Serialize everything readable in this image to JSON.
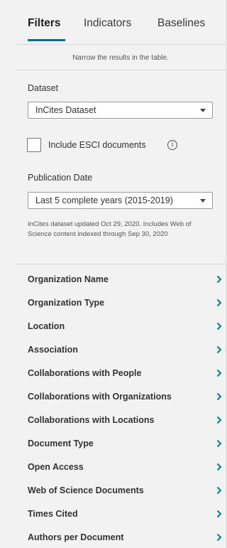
{
  "tabs": [
    {
      "label": "Filters",
      "active": true
    },
    {
      "label": "Indicators",
      "active": false
    },
    {
      "label": "Baselines",
      "active": false
    }
  ],
  "hint": "Narrow the results in the table.",
  "dataset": {
    "label": "Dataset",
    "selected": "InCites Dataset"
  },
  "esci": {
    "label": "Include ESCI documents",
    "checked": false,
    "info_icon": "info-icon"
  },
  "publication_date": {
    "label": "Publication Date",
    "selected": "Last 5 complete years (2015-2019)"
  },
  "dataset_note": "InCites dataset updated Oct 29, 2020. Includes Web of Science content indexed through Sep 30, 2020",
  "filters": [
    "Organization Name",
    "Organization Type",
    "Location",
    "Association",
    "Collaborations with People",
    "Collaborations with Organizations",
    "Collaborations with Locations",
    "Document Type",
    "Open Access",
    "Web of Science Documents",
    "Times Cited",
    "Authors per Document"
  ],
  "colors": {
    "accent": "#0a6f82",
    "panel_bg": "#f2f2f2",
    "chevron": "#0a7a8c"
  }
}
